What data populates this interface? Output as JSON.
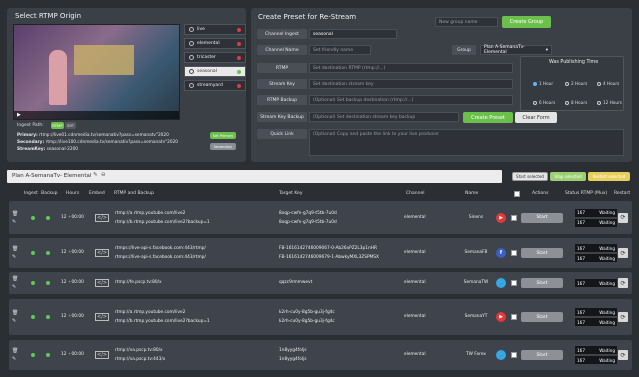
{
  "origin": {
    "title": "Select RTMP Origin",
    "sources": [
      {
        "label": "live",
        "dot": "#e03a3a"
      },
      {
        "label": "elemental",
        "dot": "#e03a3a"
      },
      {
        "label": "tricaster",
        "dot": "#e03a3a"
      },
      {
        "label": "seasonal",
        "dot": "#5ccd4e",
        "selected": true
      },
      {
        "label": "streamyard",
        "dot": "#e03a3a"
      }
    ],
    "ingest_label": "Ingest Path:",
    "ingest_tabs": [
      "RTMP",
      "SRT"
    ],
    "primary_label": "Primary:",
    "primary_value": "rtmp://live01.cdnmedia.tv/semanativ?pass=semanatv\"2020",
    "secondary_label": "Secondary:",
    "secondary_value": "rtmp://live100.cdnmedia.tv/semanativ?pass=semanatv\"2020",
    "streamkey_label": "StreamKey:",
    "streamkey_value": "seasonal-2200",
    "set_primary": "Set Primary",
    "secondary_btn": "Secondary"
  },
  "preset": {
    "title": "Create Preset for Re-Stream",
    "group_placeholder": "New group name",
    "create_group": "Create Group",
    "channel_ingest_label": "Channel Ingest",
    "channel_ingest_value": "seasonal",
    "channel_name_label": "Channel Name",
    "channel_name_placeholder": "Set friendly name",
    "group_label": "Group",
    "group_value": "Plan A-SemanaTv- Elemental",
    "rtmp_label": "RTMP",
    "rtmp_placeholder": "Set destination RTMP (rtmp://...)",
    "streamkey_label": "Stream Key",
    "streamkey_placeholder": "Set destination stream key",
    "rtmp_backup_label": "RTMP Backup",
    "rtmp_backup_placeholder": "(Optional) Set backup destination (rtmp://...)",
    "sk_backup_label": "Stream Key Backup",
    "sk_backup_placeholder": "(Optional) Set destination stream key backup",
    "quick_link_label": "Quick Link",
    "quick_link_placeholder": "(Optional) Copy and paste the link to your live producer",
    "create_preset": "Create Preset",
    "clear_form": "Clear Form",
    "publishing_title": "Was Publishing Time",
    "publishing_options": [
      {
        "label": "1 Hour",
        "on": true
      },
      {
        "label": "2 Hours",
        "on": false
      },
      {
        "label": "4 Hours",
        "on": false
      },
      {
        "label": "6 Hours",
        "on": false
      },
      {
        "label": "8 Hours",
        "on": false
      },
      {
        "label": "12 Hours",
        "on": false
      }
    ]
  },
  "plan": {
    "name": "Plan A-SemanaTv- Elemental",
    "start_selected": "Start selected",
    "stop_selected": "Stop selected",
    "restart_selected": "Restart selected"
  },
  "table": {
    "headers": {
      "ingest": "Ingest",
      "backup": "Backup",
      "hours": "Hours",
      "embed": "Embed",
      "rtmp": "RTMP and Backup",
      "target": "Target Key",
      "channel": "Channel",
      "name": "Name",
      "actions": "Actions",
      "status": "Status RTMP (Mux)",
      "restart": "Restart"
    },
    "rows": [
      {
        "hours": "12",
        "time": "00:00",
        "rtmp1": "rtmp://a.rtmp.youtube.com/live2",
        "rtmp2": "rtmp://b.rtmp.youtube.com/live2?backup=1",
        "key1": "8xqp-cwfn-g7q9-t5tb-7u0d",
        "key2": "8xqp-cwfn-g7q9-t5tb-7u0d",
        "channel": "elemental",
        "name": "Sinens",
        "badge": "yt",
        "start": "Start",
        "s1": "167",
        "s1v": "Waiting",
        "s2": "167",
        "s2v": "Waiting"
      },
      {
        "hours": "12",
        "time": "00:00",
        "rtmp1": "rtmps://live-api-s.facebook.com:443/rtmp/",
        "rtmp2": "rtmps://live-api-s.facebook.com:443/rtmp/",
        "key1": "FB-1616142746009067-0-Ab26xPZ2L3p1nHR",
        "key2": "FB-1616142746009679-1-AbwkyMXL3ZSPMSX",
        "channel": "elemental",
        "name": "SemanaFB",
        "badge": "fb",
        "start": "Start",
        "s1": "167",
        "s1v": "Waiting",
        "s2": "167",
        "s2v": "Waiting"
      },
      {
        "hours": "12",
        "time": "00:00",
        "rtmp1": "rtmp://fe.pscp.tv:80/x",
        "rtmp2": "",
        "key1": "qqzc9rmmwevt",
        "key2": "",
        "channel": "elemental",
        "name": "SemanaTW",
        "badge": "tw",
        "start": "Start",
        "s1": "167",
        "s1v": "Waiting",
        "s2": "",
        "s2v": ""
      },
      {
        "hours": "12",
        "time": "00:00",
        "rtmp1": "rtmp://a.rtmp.youtube.com/live2",
        "rtmp2": "rtmp://b.rtmp.youtube.com/live2?backup=1",
        "key1": "k2rh-cu0y-8g5b-gu3j-fg4c",
        "key2": "k2rh-cu0y-8g5b-gu3j-fg4c",
        "channel": "elemental",
        "name": "SemanaYT",
        "badge": "yt",
        "start": "Start",
        "s1": "167",
        "s1v": "Waiting",
        "s2": "167",
        "s2v": "Waiting"
      },
      {
        "hours": "12",
        "time": "00:00",
        "rtmp1": "rtmp://va.pscp.tv:80/x",
        "rtmp2": "rtmp://va.pscp.tv:443/x",
        "key1": "1n8yyg4foljs",
        "key2": "1n8yyg4foljs",
        "channel": "elemental",
        "name": "TW Forex",
        "badge": "tw",
        "start": "Start",
        "s1": "167",
        "s1v": "Waiting",
        "s2": "167",
        "s2v": "Waiting"
      }
    ]
  },
  "colors": {
    "green": "#6bc04b",
    "yt": "#e0393a",
    "fb": "#3b5fc4",
    "tw": "#33a8e8"
  }
}
